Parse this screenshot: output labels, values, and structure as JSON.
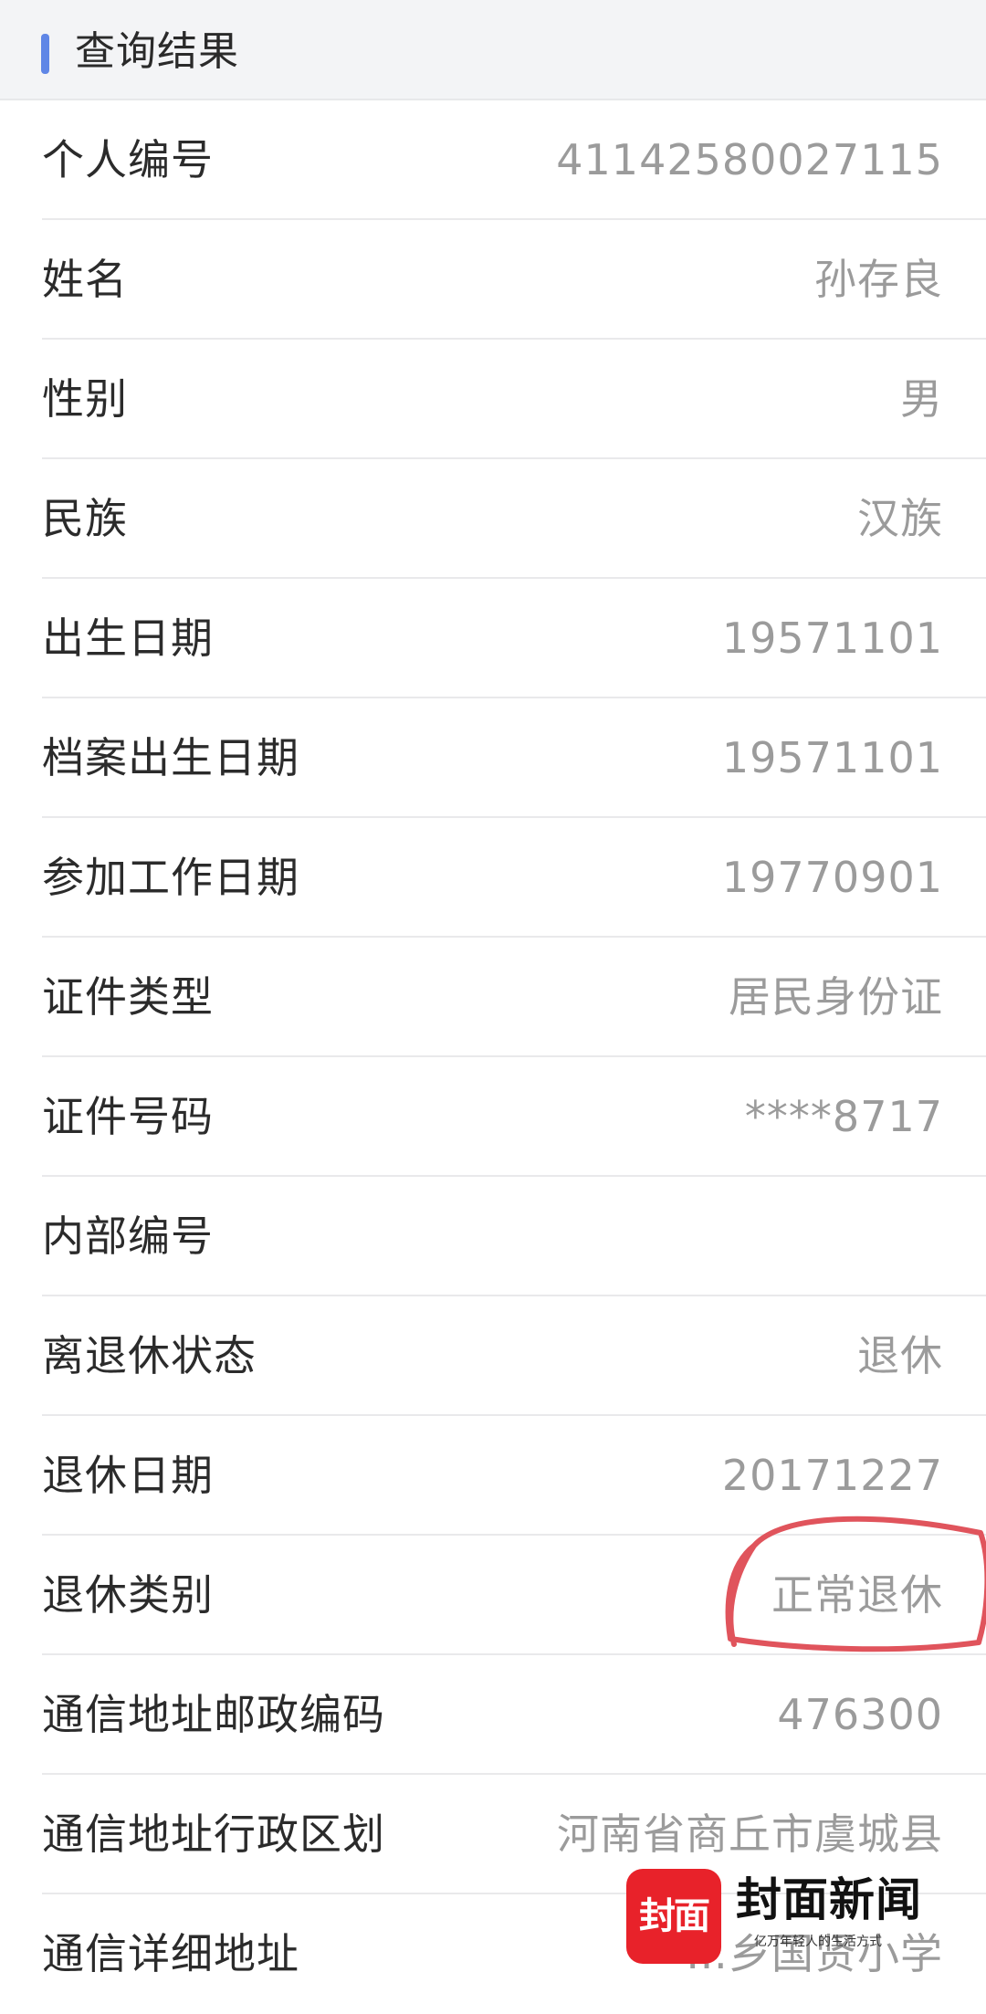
{
  "header": {
    "title": "查询结果",
    "accent_color": "#5f86e6"
  },
  "rows": [
    {
      "label": "个人编号",
      "value": "41142580027115"
    },
    {
      "label": "姓名",
      "value": "孙存良"
    },
    {
      "label": "性别",
      "value": "男"
    },
    {
      "label": "民族",
      "value": "汉族"
    },
    {
      "label": "出生日期",
      "value": "19571101"
    },
    {
      "label": "档案出生日期",
      "value": "19571101"
    },
    {
      "label": "参加工作日期",
      "value": "19770901"
    },
    {
      "label": "证件类型",
      "value": "居民身份证"
    },
    {
      "label": "证件号码",
      "value": "****8717"
    },
    {
      "label": "内部编号",
      "value": ""
    },
    {
      "label": "离退休状态",
      "value": "退休"
    },
    {
      "label": "退休日期",
      "value": "20171227"
    },
    {
      "label": "退休类别",
      "value": "正常退休"
    },
    {
      "label": "通信地址邮政编码",
      "value": "476300"
    },
    {
      "label": "通信地址行政区划",
      "value": "河南省商丘市虞城县"
    },
    {
      "label": "通信详细地址",
      "value": "…乡国贤小学"
    }
  ],
  "annotation": {
    "color": "#e0545c"
  },
  "watermark": {
    "logo_text": "封面",
    "brand_name": "封面新闻",
    "slogan": "亿万年轻人的生活方式",
    "logo_color": "#e8222a"
  }
}
